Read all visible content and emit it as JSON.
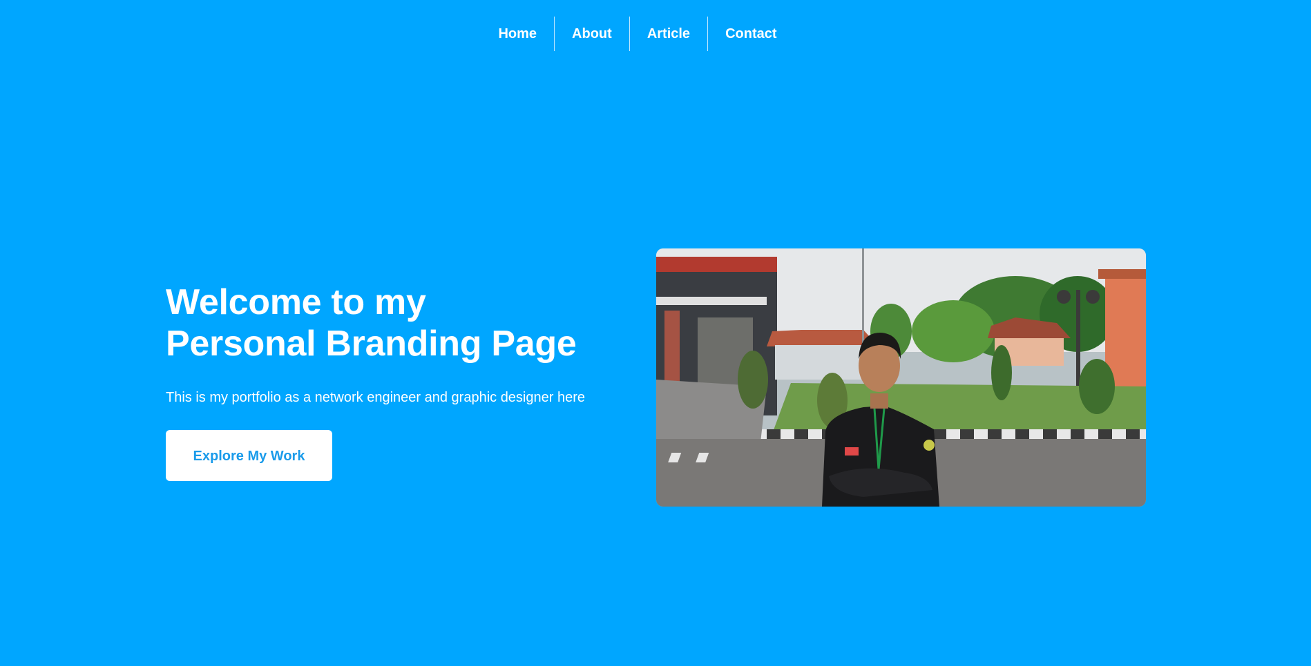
{
  "nav": {
    "items": [
      {
        "label": "Home"
      },
      {
        "label": "About"
      },
      {
        "label": "Article"
      },
      {
        "label": "Contact"
      }
    ]
  },
  "hero": {
    "title_line1": "Welcome to my",
    "title_line2": "Personal Branding Page",
    "description": "This is my portfolio as a network engineer and graphic designer here",
    "cta_label": "Explore My Work"
  },
  "colors": {
    "background": "#00a6ff",
    "text": "#ffffff",
    "button_bg": "#ffffff",
    "button_text": "#1a9bea"
  },
  "photo": {
    "alt": "Portrait photo of a young man in a black jacket standing in a paved campus courtyard"
  }
}
